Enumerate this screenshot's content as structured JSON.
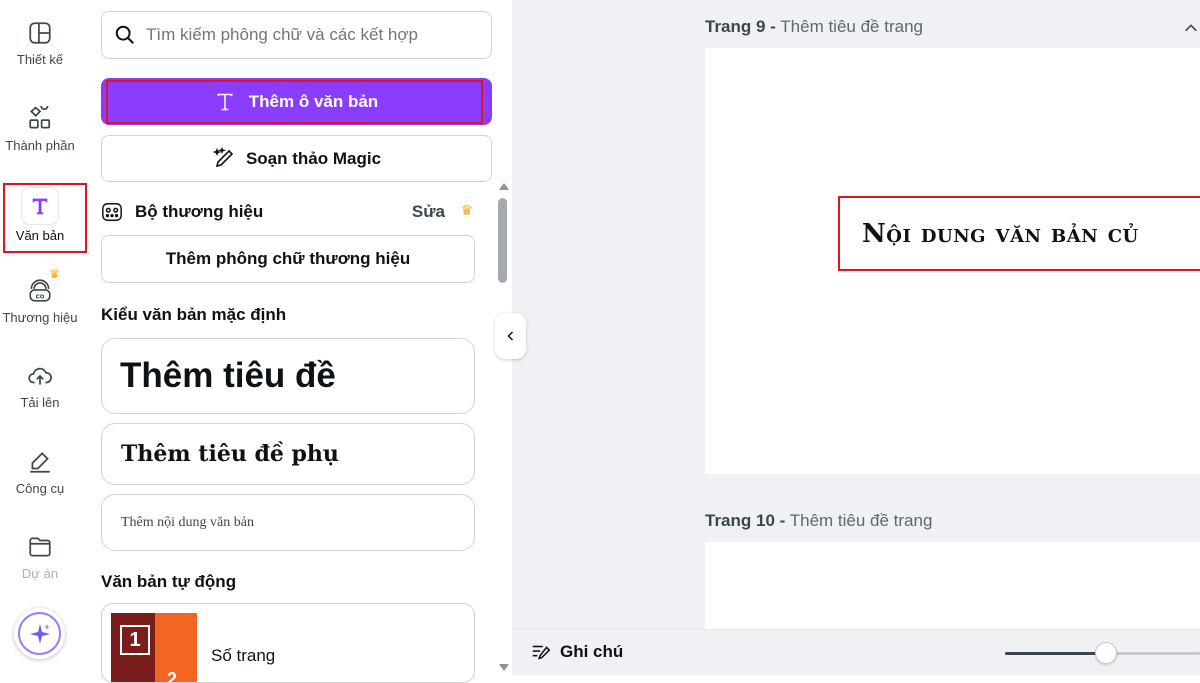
{
  "sidebar": {
    "items": [
      {
        "label": "Thiết kế",
        "icon": "layout-icon"
      },
      {
        "label": "Thành phần",
        "icon": "shapes-icon"
      },
      {
        "label": "Văn bản",
        "icon": "text-icon",
        "active": true
      },
      {
        "label": "Thương hiệu",
        "icon": "brand-icon"
      },
      {
        "label": "Tải lên",
        "icon": "cloud-upload-icon"
      },
      {
        "label": "Công cụ",
        "icon": "pen-tool-icon"
      },
      {
        "label": "Dự án",
        "icon": "folder-icon"
      }
    ],
    "magic_button_icon": "sparkle-icon"
  },
  "panel": {
    "search": {
      "placeholder": "Tìm kiếm phông chữ và các kết hợp"
    },
    "add_textbox_label": "Thêm ô văn bản",
    "magic_write_label": "Soạn thảo Magic",
    "brand_kit": {
      "title": "Bộ thương hiệu",
      "edit_label": "Sửa",
      "add_brand_font_label": "Thêm phông chữ thương hiệu"
    },
    "default_styles": {
      "title": "Kiểu văn bản mặc định",
      "heading": "Thêm tiêu đề",
      "subheading": "Thêm tiêu đề phụ",
      "body": "Thêm nội dung văn bản"
    },
    "auto_text": {
      "title": "Văn bản tự động",
      "items": [
        {
          "label": "Số trang",
          "thumb_number": "1",
          "thumb_number_2": "2"
        }
      ]
    }
  },
  "canvas": {
    "pages": [
      {
        "number_label": "Trang 9 -",
        "title_label": "Thêm tiêu đề trang",
        "text": "Nội dung văn bản củ"
      },
      {
        "number_label": "Trang 10 -",
        "title_label": "Thêm tiêu đề trang"
      }
    ]
  },
  "bottom_bar": {
    "notes_label": "Ghi chú",
    "zoom_level": 0.52
  },
  "colors": {
    "accent": "#8b3dff",
    "highlight": "#e0141e",
    "crown": "#f3a712"
  }
}
